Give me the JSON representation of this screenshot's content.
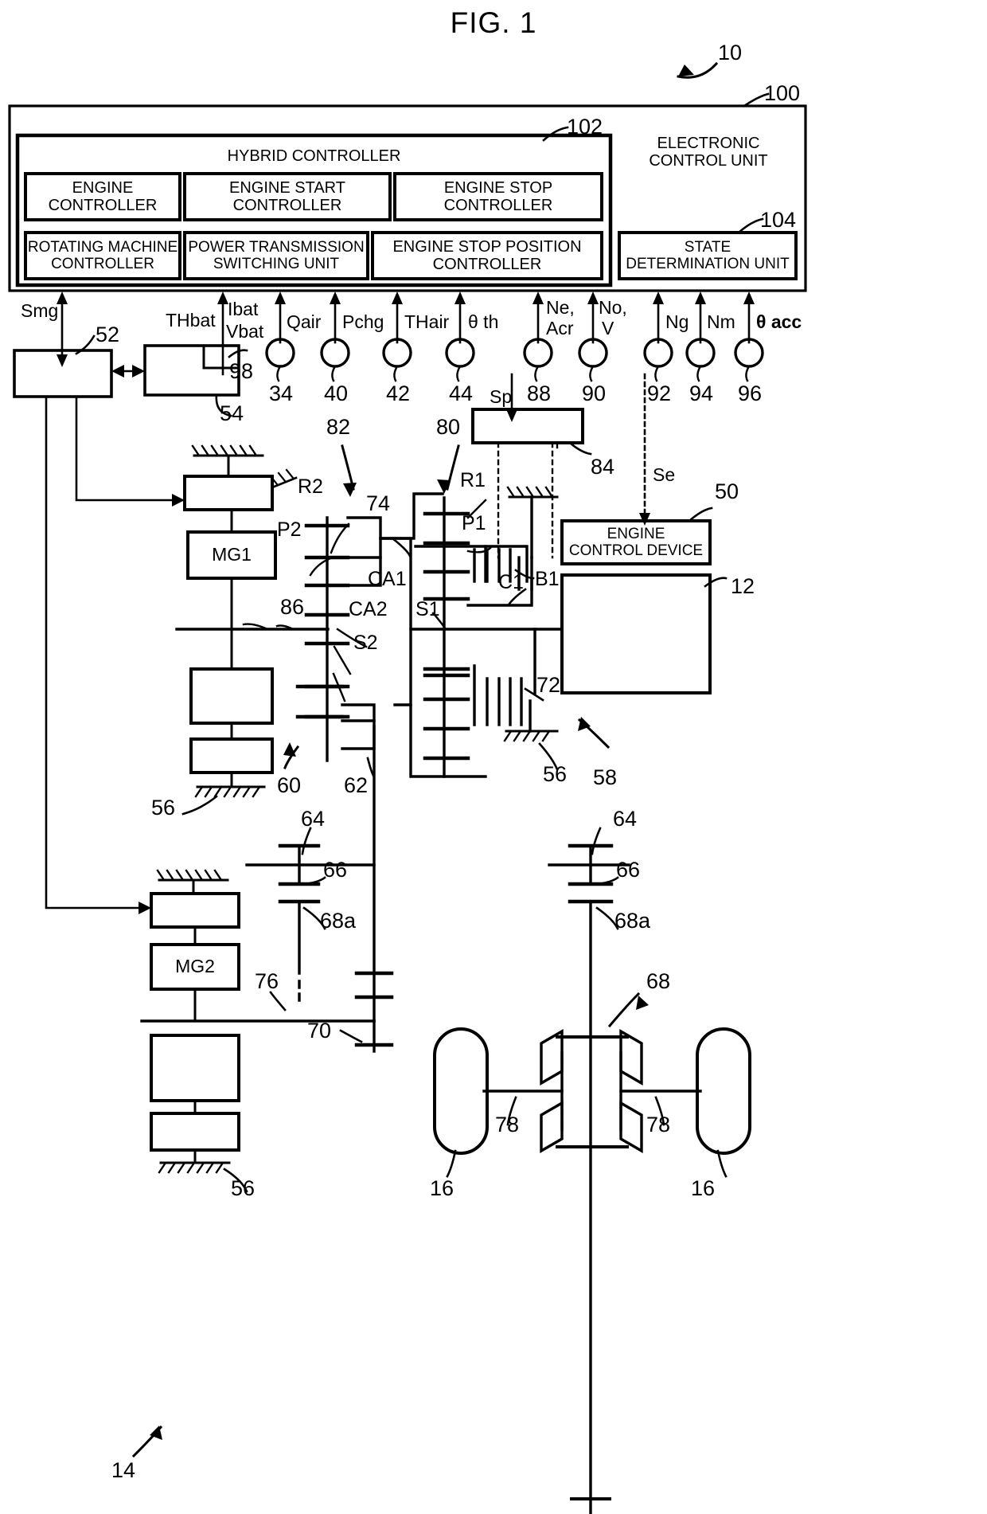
{
  "figure": {
    "title": "FIG. 1",
    "top_ref": "10"
  },
  "ecu": {
    "ref": "100",
    "title_line1": "ELECTRONIC",
    "title_line2": "CONTROL UNIT",
    "hybrid_controller": {
      "ref": "102",
      "label": "HYBRID CONTROLLER",
      "modules_row1": [
        {
          "line1": "ENGINE",
          "line2": "CONTROLLER"
        },
        {
          "line1": "ENGINE START",
          "line2": "CONTROLLER"
        },
        {
          "line1": "ENGINE STOP",
          "line2": "CONTROLLER"
        }
      ],
      "modules_row2": [
        {
          "line1": "ROTATING MACHINE",
          "line2": "CONTROLLER"
        },
        {
          "line1": "POWER TRANSMISSION",
          "line2": "SWITCHING UNIT"
        },
        {
          "line1": "ENGINE STOP POSITION",
          "line2": "CONTROLLER"
        }
      ]
    },
    "state_determination_unit": {
      "ref": "104",
      "line1": "STATE",
      "line2": "DETERMINATION UNIT"
    }
  },
  "signals": {
    "smg": "Smg",
    "thbat": "THbat",
    "ibat": "Ibat",
    "vbat": "Vbat",
    "qair": "Qair",
    "pchg": "Pchg",
    "thair": "THair",
    "theta_th": "θ th",
    "ne": "Ne,",
    "acr": "Acr",
    "no": "No,",
    "v": "V",
    "ng": "Ng",
    "nm": "Nm",
    "theta_acc": "θ acc",
    "sp": "Sp",
    "se": "Se"
  },
  "refs": {
    "r52": "52",
    "r54": "54",
    "r98": "98",
    "r34": "34",
    "r40": "40",
    "r42": "42",
    "r44": "44",
    "r88": "88",
    "r90": "90",
    "r92": "92",
    "r94": "94",
    "r96": "96",
    "r80": "80",
    "r82": "82",
    "r84": "84",
    "r74": "74",
    "r86": "86",
    "r50": "50",
    "r12": "12",
    "r56a": "56",
    "r56b": "56",
    "r56c": "56",
    "r58": "58",
    "r60": "60",
    "r62": "62",
    "r64a": "64",
    "r64b": "64",
    "r66a": "66",
    "r66b": "66",
    "r68": "68",
    "r68a_left": "68a",
    "r68a_right": "68a",
    "r70": "70",
    "r72": "72",
    "r76": "76",
    "r78a": "78",
    "r78b": "78",
    "r16a": "16",
    "r16b": "16",
    "r14": "14"
  },
  "gears": {
    "r1": "R1",
    "r2": "R2",
    "p1": "P1",
    "p2": "P2",
    "ca1": "CA1",
    "ca2": "CA2",
    "s1": "S1",
    "s2": "S2",
    "c1": "C1",
    "b1": "B1"
  },
  "machines": {
    "mg1": "MG1",
    "mg2": "MG2"
  },
  "engine_control_device": {
    "line1": "ENGINE",
    "line2": "CONTROL DEVICE"
  },
  "colors": {
    "line": "#000000",
    "background": "#ffffff"
  }
}
